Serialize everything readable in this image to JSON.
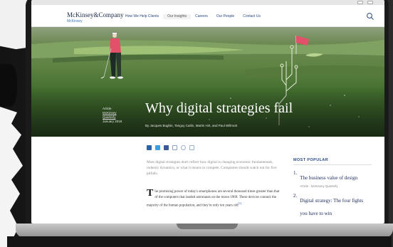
{
  "browser": {
    "buttons": [
      "restore",
      "close"
    ]
  },
  "site": {
    "logo": "McKinsey&Company",
    "logo_sub": "McKinsey",
    "nav": [
      "How We Help Clients",
      "Our Insights",
      "Careers",
      "Our People",
      "Contact Us"
    ]
  },
  "hero": {
    "title": "Why digital strategies fail",
    "authors": "By Jacques Bughin, Tanguy Catlin, Martin Hirt, and Paul Willmott",
    "meta": {
      "type": "Article",
      "source_line1": "McKinsey",
      "source_line2": "Quarterly",
      "date": "January 2018"
    }
  },
  "share": {
    "icons": [
      "linkedin-icon",
      "twitter-icon",
      "facebook-icon",
      "email-icon",
      "print-icon",
      "download-icon"
    ],
    "colors": [
      "#2a64a8",
      "#3aa0e0",
      "#3b5998",
      "#8aa0c8",
      "#9ab0d0",
      "#9ab0d0"
    ]
  },
  "article": {
    "summary": "Most digital strategies don't reflect how digital is changing economic fundamentals, industry dynamics, or what it means to compete. Companies should watch out for five pitfalls.",
    "dropcap": "T",
    "body": "he promising power of today's smartphones are several thousand times greater than that of the computers that landed astronauts on the moon 1969. These devices connect the majority of the human population, and they're only ten years old",
    "footnote": "[1]"
  },
  "sidebar": {
    "heading": "MOST POPULAR",
    "items": [
      {
        "num": "1.",
        "title": "The business value of design",
        "source": "Article - McKinsey Quarterly"
      },
      {
        "num": "2.",
        "title": "Digital strategy: The four fights you have to win",
        "source": ""
      }
    ]
  },
  "colors": {
    "nav_text": "#2a4a7a",
    "sidebar_accent": "#2a4a8a",
    "flag": "#e2506a",
    "grass": "#5f8444"
  }
}
